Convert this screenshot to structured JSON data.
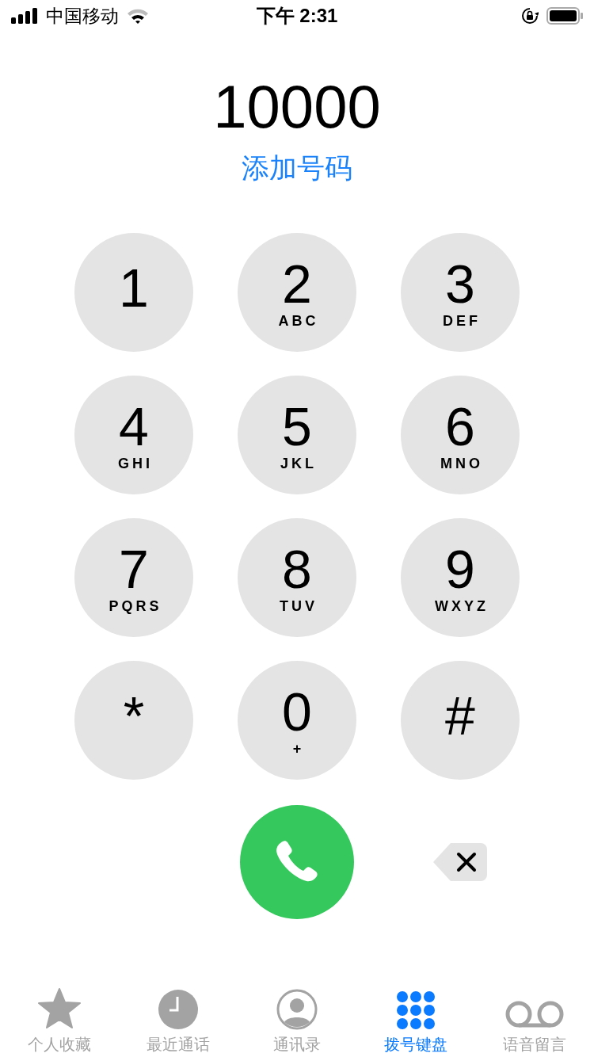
{
  "status_bar": {
    "carrier": "中国移动",
    "time": "下午 2:31"
  },
  "number": "10000",
  "add_number_link": "添加号码",
  "keys": [
    {
      "digit": "1"
    },
    {
      "digit": "2",
      "letters": "ABC"
    },
    {
      "digit": "3",
      "letters": "DEF"
    },
    {
      "digit": "4",
      "letters": "GHI"
    },
    {
      "digit": "5",
      "letters": "JKL"
    },
    {
      "digit": "6",
      "letters": "MNO"
    },
    {
      "digit": "7",
      "letters": "PQRS"
    },
    {
      "digit": "8",
      "letters": "TUV"
    },
    {
      "digit": "9",
      "letters": "WXYZ"
    },
    {
      "digit": "*"
    },
    {
      "digit": "0",
      "letters": "+"
    },
    {
      "digit": "#"
    }
  ],
  "tabs": [
    {
      "kind": "favorites",
      "label": "个人收藏",
      "selected": false
    },
    {
      "kind": "recents",
      "label": "最近通话",
      "selected": false
    },
    {
      "kind": "contacts",
      "label": "通讯录",
      "selected": false
    },
    {
      "kind": "keypad",
      "label": "拨号键盘",
      "selected": true
    },
    {
      "kind": "voicemail",
      "label": "语音留言",
      "selected": false
    }
  ]
}
